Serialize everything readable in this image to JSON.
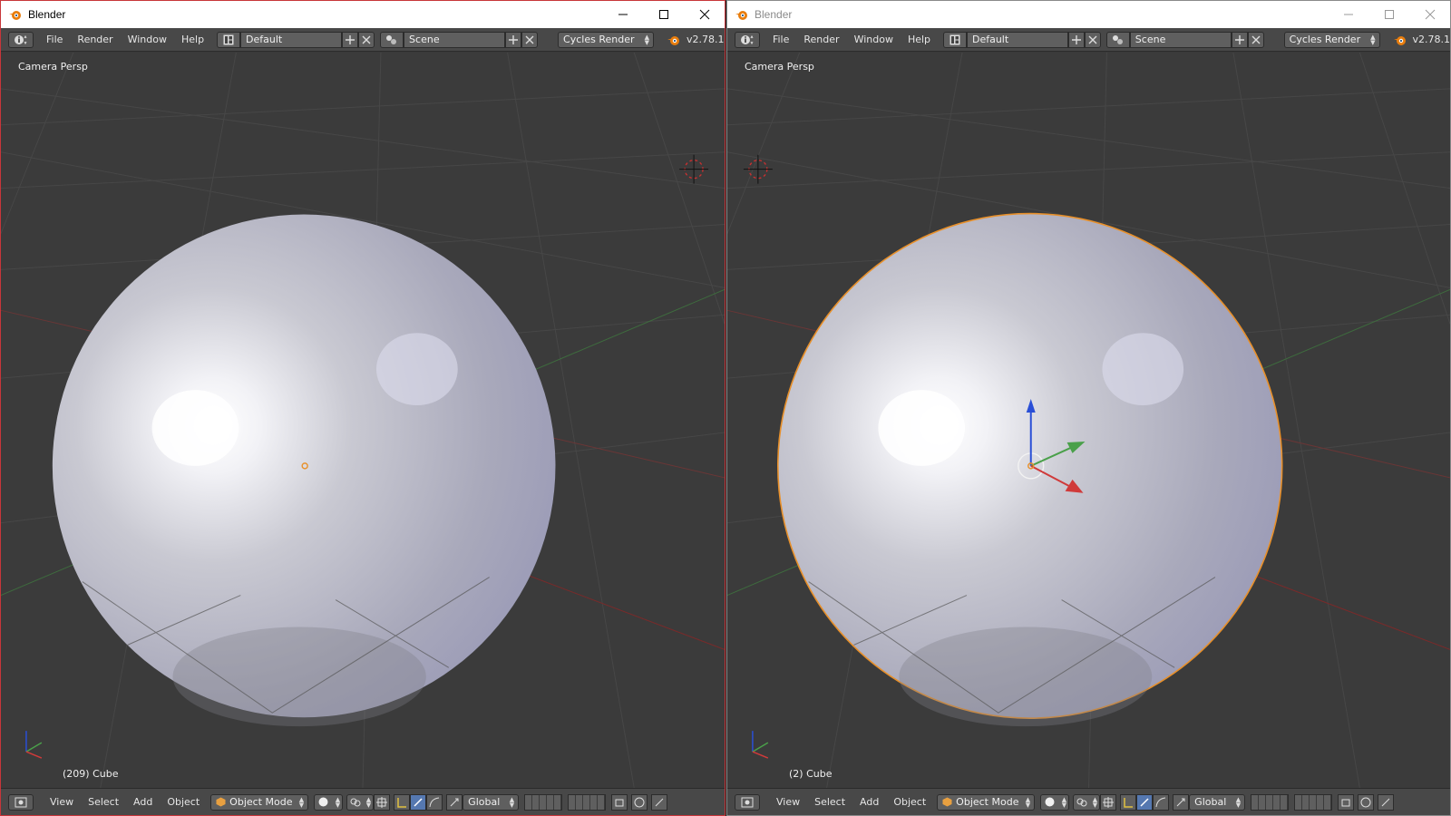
{
  "windows": [
    {
      "title": "Blender",
      "active": true,
      "menus": [
        "File",
        "Render",
        "Window",
        "Help"
      ],
      "screen_layout": "Default",
      "scene": "Scene",
      "render_engine": "Cycles Render",
      "version": "v2.78.1",
      "view_label": "Camera Persp",
      "object_label": "(209) Cube",
      "footer_menus": [
        "View",
        "Select",
        "Add",
        "Object"
      ],
      "mode": "Object Mode",
      "orientation": "Global",
      "object_selected": false
    },
    {
      "title": "Blender",
      "active": false,
      "menus": [
        "File",
        "Render",
        "Window",
        "Help"
      ],
      "screen_layout": "Default",
      "scene": "Scene",
      "render_engine": "Cycles Render",
      "version": "v2.78.1",
      "view_label": "Camera Persp",
      "object_label": "(2) Cube",
      "footer_menus": [
        "View",
        "Select",
        "Add",
        "Object"
      ],
      "mode": "Object Mode",
      "orientation": "Global",
      "object_selected": true
    }
  ],
  "colors": {
    "selection_outline": "#e8902a",
    "viewport_bg": "#3b3b3b",
    "active_window_border": "#c8363a",
    "x_axis": "#d03a3a",
    "y_axis": "#4aa04a",
    "z_axis": "#2a4fd6"
  },
  "icons": [
    "blender-logo-icon",
    "info-editor-icon",
    "screen-layout-icon",
    "scene-icon",
    "add-icon",
    "close-icon",
    "minimize-icon",
    "maximize-icon",
    "cursor-3d-icon",
    "viewport-shading-icon",
    "pivot-icon",
    "manipulator-icon",
    "layer-grid-icon"
  ]
}
